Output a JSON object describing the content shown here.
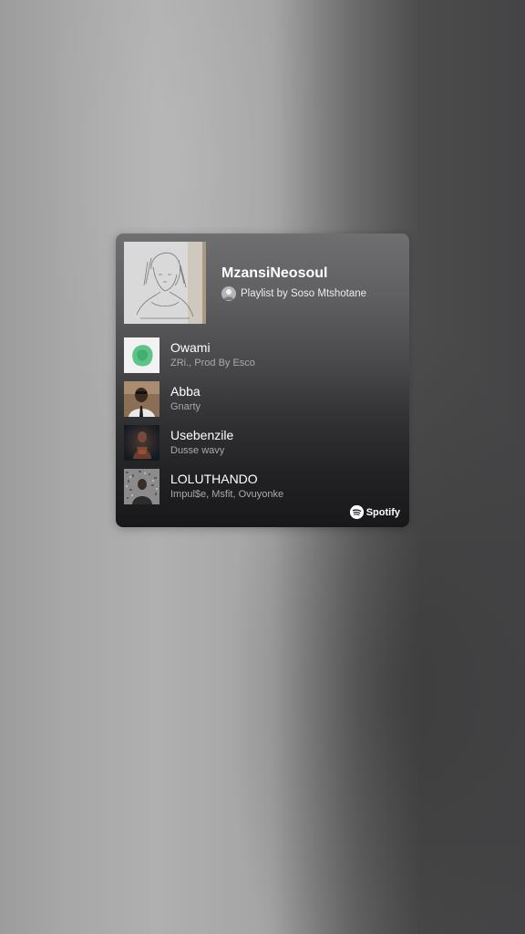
{
  "playlist": {
    "title": "MzansiNeosoul",
    "owner_text": "Playlist by Soso Mtshotane"
  },
  "tracks": [
    {
      "title": "Owami",
      "artist": "ZRi., Prod By Esco",
      "thumb_icon": "green-cover-art"
    },
    {
      "title": "Abba",
      "artist": "Gnarty",
      "thumb_icon": "portrait-cover-art"
    },
    {
      "title": "Usebenzile",
      "artist": "Dusse wavy",
      "thumb_icon": "dark-portrait-cover-art"
    },
    {
      "title": "LOLUTHANDO",
      "artist": "Impul$e, Msfit, Ovuyonke",
      "thumb_icon": "noise-portrait-cover-art"
    }
  ],
  "branding": {
    "label": "Spotify",
    "icon": "spotify-icon"
  },
  "colors": {
    "card_top": "#6f6f72",
    "card_bottom": "#18181a",
    "title_text": "#ffffff",
    "artist_text": "#a9a9ab"
  }
}
